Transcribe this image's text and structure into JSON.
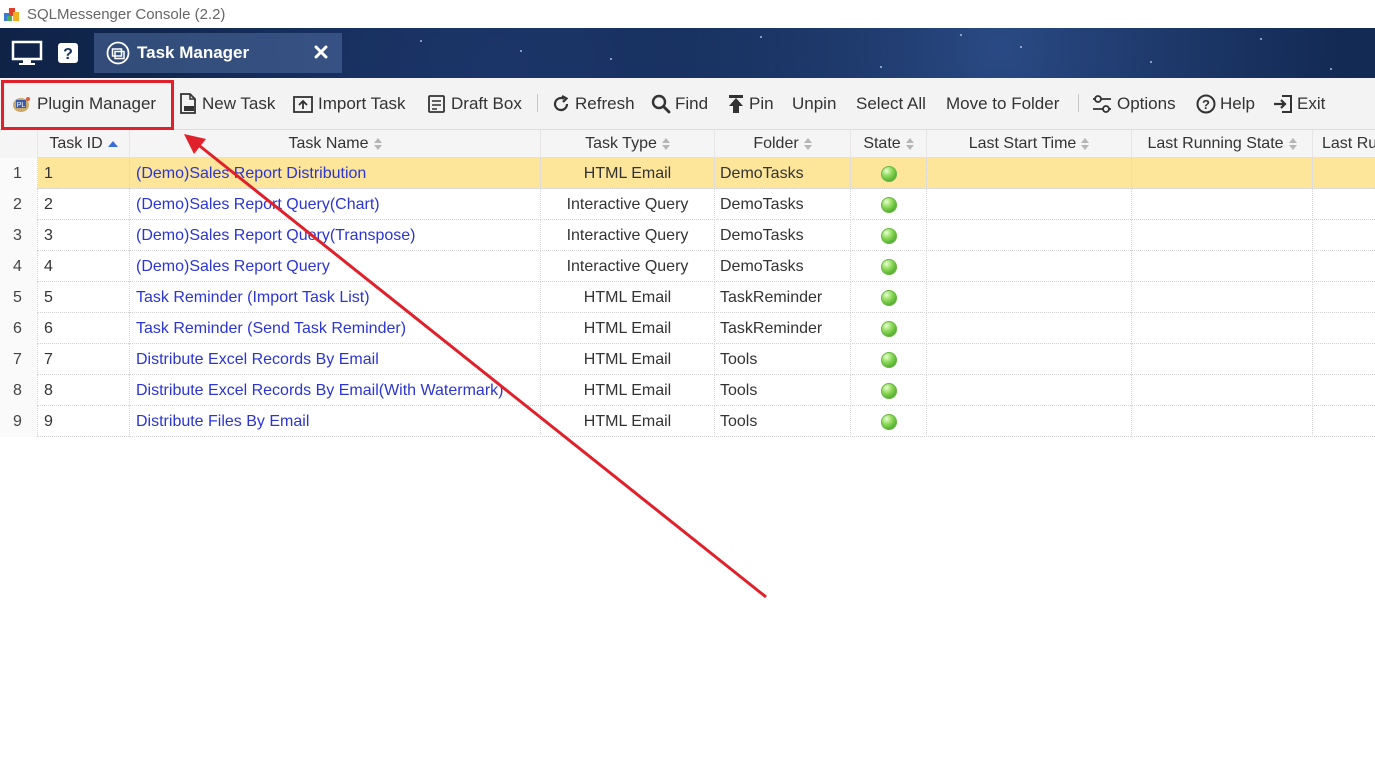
{
  "window": {
    "title": "SQLMessenger Console (2.2)"
  },
  "header": {
    "tab": {
      "label": "Task Manager",
      "close": "✖"
    }
  },
  "toolbar": {
    "items": [
      {
        "label": "Plugin Manager",
        "icon": "plugin-icon"
      },
      {
        "label": "New Task",
        "icon": "new-task-icon"
      },
      {
        "label": "Import Task",
        "icon": "import-icon"
      },
      {
        "label": "Draft Box",
        "icon": "draft-box-icon"
      },
      {
        "label": "Refresh",
        "icon": "refresh-icon"
      },
      {
        "label": "Find",
        "icon": "search-icon"
      },
      {
        "label": "Pin",
        "icon": "pin-icon"
      },
      {
        "label": "Unpin",
        "icon": ""
      },
      {
        "label": "Select All",
        "icon": ""
      },
      {
        "label": "Move to Folder",
        "icon": ""
      },
      {
        "label": "Options",
        "icon": "options-icon"
      },
      {
        "label": "Help",
        "icon": "help-icon"
      },
      {
        "label": "Exit",
        "icon": "exit-icon"
      }
    ],
    "highlight_color": "#e0202a"
  },
  "table": {
    "columns": [
      "Task ID",
      "Task Name",
      "Task Type",
      "Folder",
      "State",
      "Last Start Time",
      "Last Running State",
      "Last Ru"
    ],
    "rows": [
      {
        "num": "1",
        "id": "1",
        "name": "(Demo)Sales Report Distribution",
        "type": "HTML Email",
        "folder": "DemoTasks",
        "state": "green"
      },
      {
        "num": "2",
        "id": "2",
        "name": "(Demo)Sales Report Query(Chart)",
        "type": "Interactive Query",
        "folder": "DemoTasks",
        "state": "green"
      },
      {
        "num": "3",
        "id": "3",
        "name": "(Demo)Sales Report Query(Transpose)",
        "type": "Interactive Query",
        "folder": "DemoTasks",
        "state": "green"
      },
      {
        "num": "4",
        "id": "4",
        "name": "(Demo)Sales Report Query",
        "type": "Interactive Query",
        "folder": "DemoTasks",
        "state": "green"
      },
      {
        "num": "5",
        "id": "5",
        "name": "Task Reminder (Import Task List)",
        "type": "HTML Email",
        "folder": "TaskReminder",
        "state": "green"
      },
      {
        "num": "6",
        "id": "6",
        "name": "Task Reminder (Send Task Reminder)",
        "type": "HTML Email",
        "folder": "TaskReminder",
        "state": "green"
      },
      {
        "num": "7",
        "id": "7",
        "name": "Distribute Excel Records By Email",
        "type": "HTML Email",
        "folder": "Tools",
        "state": "green"
      },
      {
        "num": "8",
        "id": "8",
        "name": "Distribute Excel Records By Email(With Watermark)",
        "type": "HTML Email",
        "folder": "Tools",
        "state": "green"
      },
      {
        "num": "9",
        "id": "9",
        "name": "Distribute Files By Email",
        "type": "HTML Email",
        "folder": "Tools",
        "state": "green"
      }
    ],
    "selected_row_color": "#fde59a",
    "link_color": "#2b35d4"
  }
}
